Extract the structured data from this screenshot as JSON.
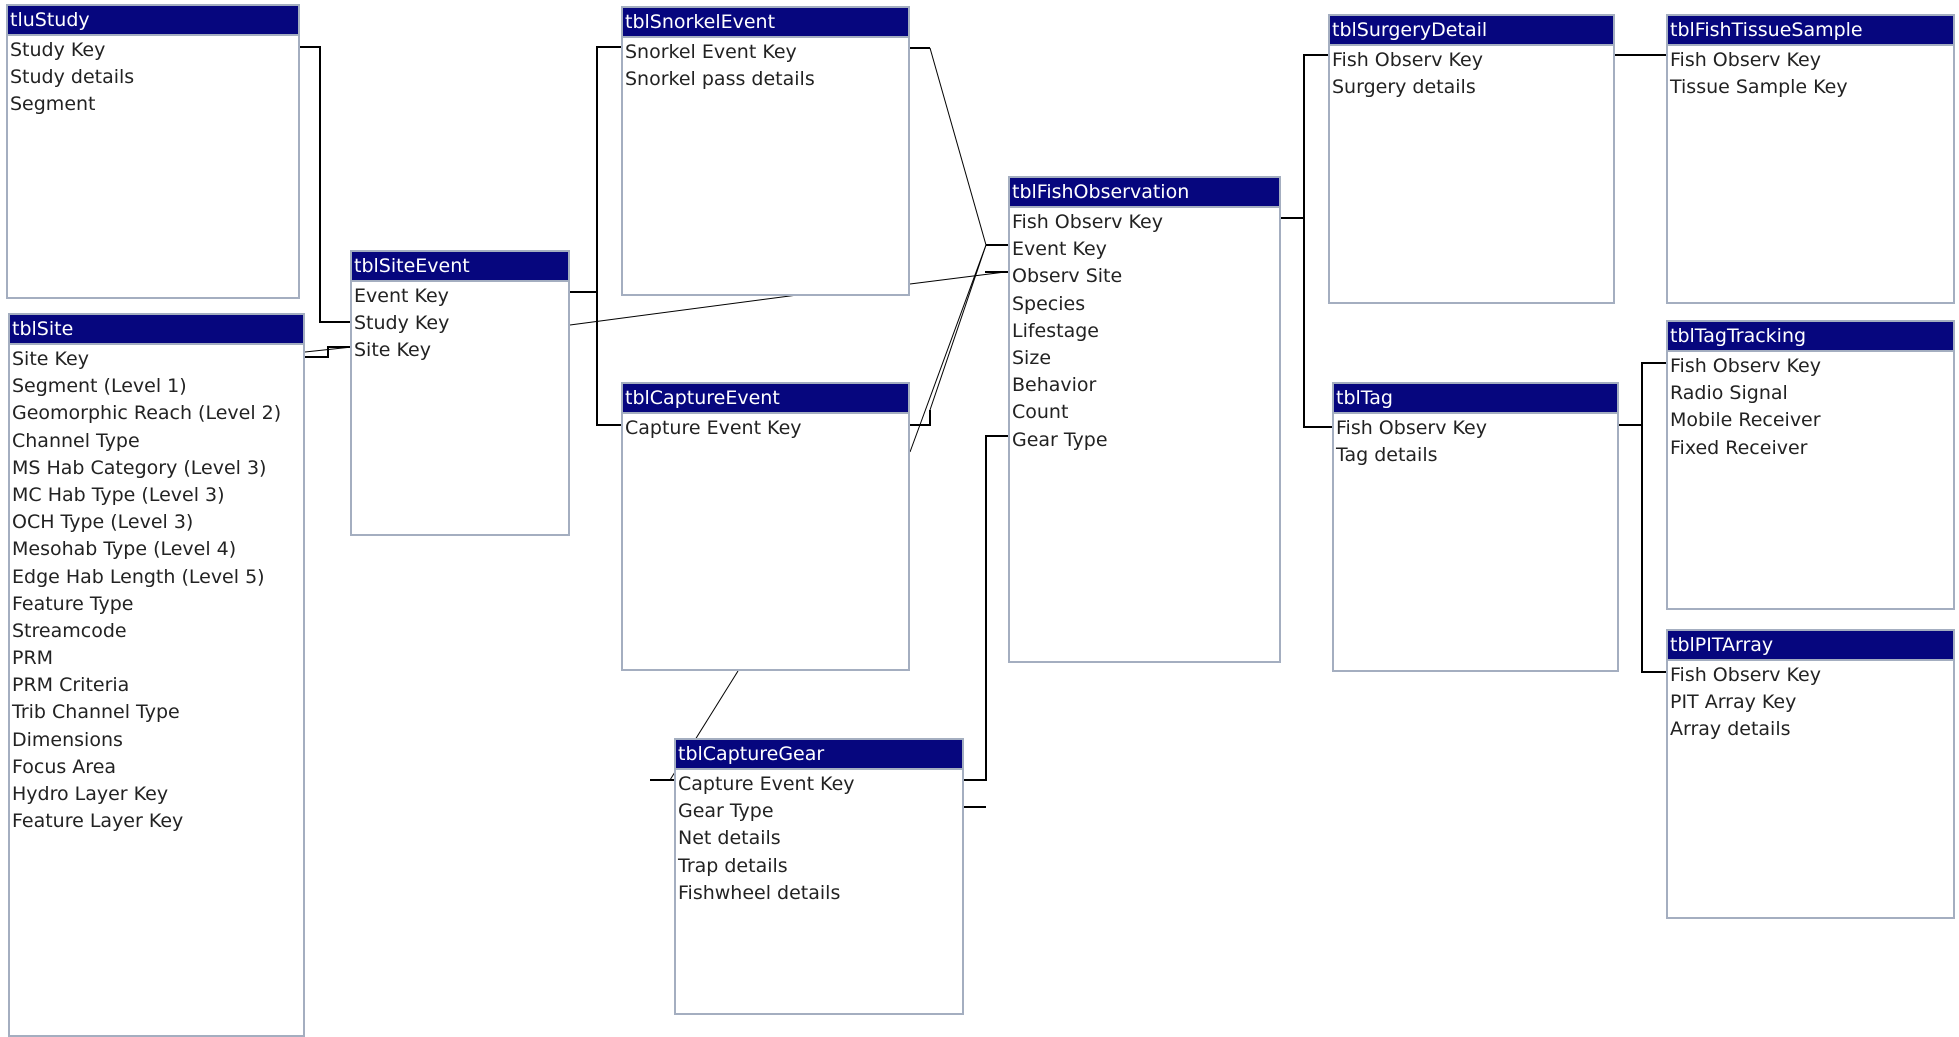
{
  "diagram": {
    "tables": [
      {
        "name": "tluStudy",
        "fields": [
          "Study Key",
          "Study details",
          "Segment"
        ]
      },
      {
        "name": "tblSite",
        "fields": [
          "Site Key",
          "Segment (Level 1)",
          "Geomorphic Reach (Level 2)",
          "Channel Type",
          "MS Hab Category (Level 3)",
          "MC Hab Type (Level 3)",
          "OCH Type (Level 3)",
          "Mesohab Type (Level 4)",
          "Edge Hab Length (Level 5)",
          "Feature Type",
          "Streamcode",
          "PRM",
          "PRM Criteria",
          "Trib Channel Type",
          "Dimensions",
          "Focus Area",
          "Hydro Layer Key",
          "Feature Layer Key"
        ]
      },
      {
        "name": "tblSiteEvent",
        "fields": [
          "Event Key",
          "Study Key",
          "Site Key"
        ]
      },
      {
        "name": "tblSnorkelEvent",
        "fields": [
          "Snorkel Event Key",
          "Snorkel pass details"
        ]
      },
      {
        "name": "tblCaptureEvent",
        "fields": [
          "Capture Event Key"
        ]
      },
      {
        "name": "tblCaptureGear",
        "fields": [
          "Capture Event Key",
          "Gear Type",
          "Net details",
          "Trap details",
          "Fishwheel details"
        ]
      },
      {
        "name": "tblFishObservation",
        "fields": [
          "Fish Observ Key",
          "Event Key",
          "Observ Site",
          "Species",
          "Lifestage",
          "Size",
          "Behavior",
          "Count",
          "Gear Type"
        ]
      },
      {
        "name": "tblSurgeryDetail",
        "fields": [
          "Fish Observ Key",
          "Surgery details"
        ]
      },
      {
        "name": "tblFishTissueSample",
        "fields": [
          "Fish Observ Key",
          "Tissue Sample Key"
        ]
      },
      {
        "name": "tblTag",
        "fields": [
          "Fish Observ Key",
          "Tag details"
        ]
      },
      {
        "name": "tblTagTracking",
        "fields": [
          "Fish Observ Key",
          "Radio Signal",
          "Mobile Receiver",
          "Fixed Receiver"
        ]
      },
      {
        "name": "tblPITArray",
        "fields": [
          "Fish Observ Key",
          "PIT Array Key",
          "Array details"
        ]
      }
    ]
  }
}
